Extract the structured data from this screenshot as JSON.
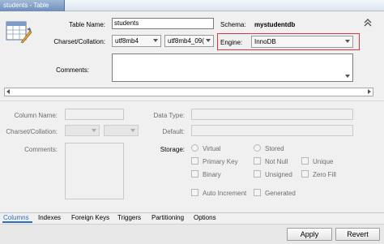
{
  "window": {
    "tab_title": "students - Table"
  },
  "form": {
    "table_name_label": "Table Name:",
    "table_name_value": "students",
    "schema_label": "Schema:",
    "schema_value": "mystudentdb",
    "charset_label": "Charset/Collation:",
    "charset_value": "utf8mb4",
    "collation_value": "utf8mb4_09(",
    "engine_label": "Engine:",
    "engine_value": "InnoDB",
    "comments_label": "Comments:"
  },
  "column_details": {
    "column_name_label": "Column Name:",
    "charset_label": "Charset/Collation:",
    "comments_label": "Comments:",
    "data_type_label": "Data Type:",
    "default_label": "Default:",
    "storage_label": "Storage:",
    "options": {
      "virtual": "Virtual",
      "stored": "Stored",
      "primary_key": "Primary Key",
      "not_null": "Not Null",
      "unique": "Unique",
      "binary": "Binary",
      "unsigned": "Unsigned",
      "zero_fill": "Zero Fill",
      "auto_increment": "Auto Increment",
      "generated": "Generated"
    }
  },
  "tabs": [
    "Columns",
    "Indexes",
    "Foreign Keys",
    "Triggers",
    "Partitioning",
    "Options"
  ],
  "buttons": {
    "apply": "Apply",
    "revert": "Revert"
  },
  "colors": {
    "accent": "#2c6ec4",
    "highlight": "#e0343c"
  },
  "icons": {
    "table": "table-edit-icon",
    "collapse": "double-chevron-up-icon"
  }
}
